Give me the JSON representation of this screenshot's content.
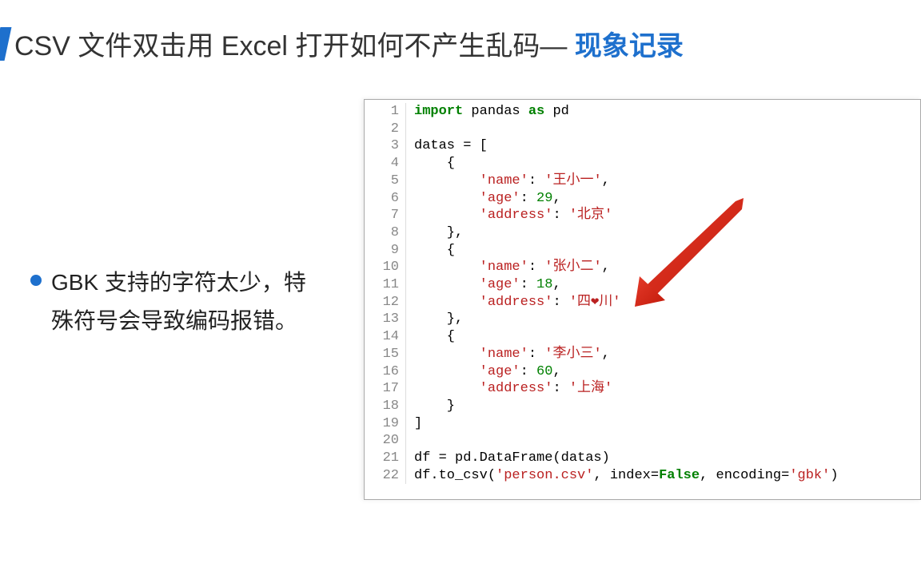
{
  "title": {
    "main": "CSV 文件双击用 Excel 打开如何不产生乱码— ",
    "emphasis": "现象记录"
  },
  "bullet": "GBK 支持的字符太少，特殊符号会导致编码报错。",
  "code": {
    "lines": [
      {
        "n": 1,
        "tokens": [
          [
            "kw",
            "import"
          ],
          [
            "plain",
            " pandas "
          ],
          [
            "kw",
            "as"
          ],
          [
            "plain",
            " pd"
          ]
        ]
      },
      {
        "n": 2,
        "tokens": []
      },
      {
        "n": 3,
        "tokens": [
          [
            "plain",
            "datas = ["
          ]
        ]
      },
      {
        "n": 4,
        "tokens": [
          [
            "plain",
            "    {"
          ]
        ]
      },
      {
        "n": 5,
        "tokens": [
          [
            "plain",
            "        "
          ],
          [
            "str",
            "'name'"
          ],
          [
            "plain",
            ": "
          ],
          [
            "str",
            "'王小一'"
          ],
          [
            "plain",
            ","
          ]
        ]
      },
      {
        "n": 6,
        "tokens": [
          [
            "plain",
            "        "
          ],
          [
            "str",
            "'age'"
          ],
          [
            "plain",
            ": "
          ],
          [
            "num",
            "29"
          ],
          [
            "plain",
            ","
          ]
        ]
      },
      {
        "n": 7,
        "tokens": [
          [
            "plain",
            "        "
          ],
          [
            "str",
            "'address'"
          ],
          [
            "plain",
            ": "
          ],
          [
            "str",
            "'北京'"
          ]
        ]
      },
      {
        "n": 8,
        "tokens": [
          [
            "plain",
            "    },"
          ]
        ]
      },
      {
        "n": 9,
        "tokens": [
          [
            "plain",
            "    {"
          ]
        ]
      },
      {
        "n": 10,
        "tokens": [
          [
            "plain",
            "        "
          ],
          [
            "str",
            "'name'"
          ],
          [
            "plain",
            ": "
          ],
          [
            "str",
            "'张小二'"
          ],
          [
            "plain",
            ","
          ]
        ]
      },
      {
        "n": 11,
        "tokens": [
          [
            "plain",
            "        "
          ],
          [
            "str",
            "'age'"
          ],
          [
            "plain",
            ": "
          ],
          [
            "num",
            "18"
          ],
          [
            "plain",
            ","
          ]
        ]
      },
      {
        "n": 12,
        "tokens": [
          [
            "plain",
            "        "
          ],
          [
            "str",
            "'address'"
          ],
          [
            "plain",
            ": "
          ],
          [
            "str",
            "'四❤川'"
          ]
        ]
      },
      {
        "n": 13,
        "tokens": [
          [
            "plain",
            "    },"
          ]
        ]
      },
      {
        "n": 14,
        "tokens": [
          [
            "plain",
            "    {"
          ]
        ]
      },
      {
        "n": 15,
        "tokens": [
          [
            "plain",
            "        "
          ],
          [
            "str",
            "'name'"
          ],
          [
            "plain",
            ": "
          ],
          [
            "str",
            "'李小三'"
          ],
          [
            "plain",
            ","
          ]
        ]
      },
      {
        "n": 16,
        "tokens": [
          [
            "plain",
            "        "
          ],
          [
            "str",
            "'age'"
          ],
          [
            "plain",
            ": "
          ],
          [
            "num",
            "60"
          ],
          [
            "plain",
            ","
          ]
        ]
      },
      {
        "n": 17,
        "tokens": [
          [
            "plain",
            "        "
          ],
          [
            "str",
            "'address'"
          ],
          [
            "plain",
            ": "
          ],
          [
            "str",
            "'上海'"
          ]
        ]
      },
      {
        "n": 18,
        "tokens": [
          [
            "plain",
            "    }"
          ]
        ]
      },
      {
        "n": 19,
        "tokens": [
          [
            "plain",
            "]"
          ]
        ]
      },
      {
        "n": 20,
        "tokens": []
      },
      {
        "n": 21,
        "tokens": [
          [
            "plain",
            "df = pd.DataFrame(datas)"
          ]
        ]
      },
      {
        "n": 22,
        "tokens": [
          [
            "plain",
            "df.to_csv("
          ],
          [
            "str",
            "'person.csv'"
          ],
          [
            "plain",
            ", index="
          ],
          [
            "kw",
            "False"
          ],
          [
            "plain",
            ", encoding="
          ],
          [
            "str",
            "'gbk'"
          ],
          [
            "plain",
            ")"
          ]
        ]
      }
    ]
  }
}
